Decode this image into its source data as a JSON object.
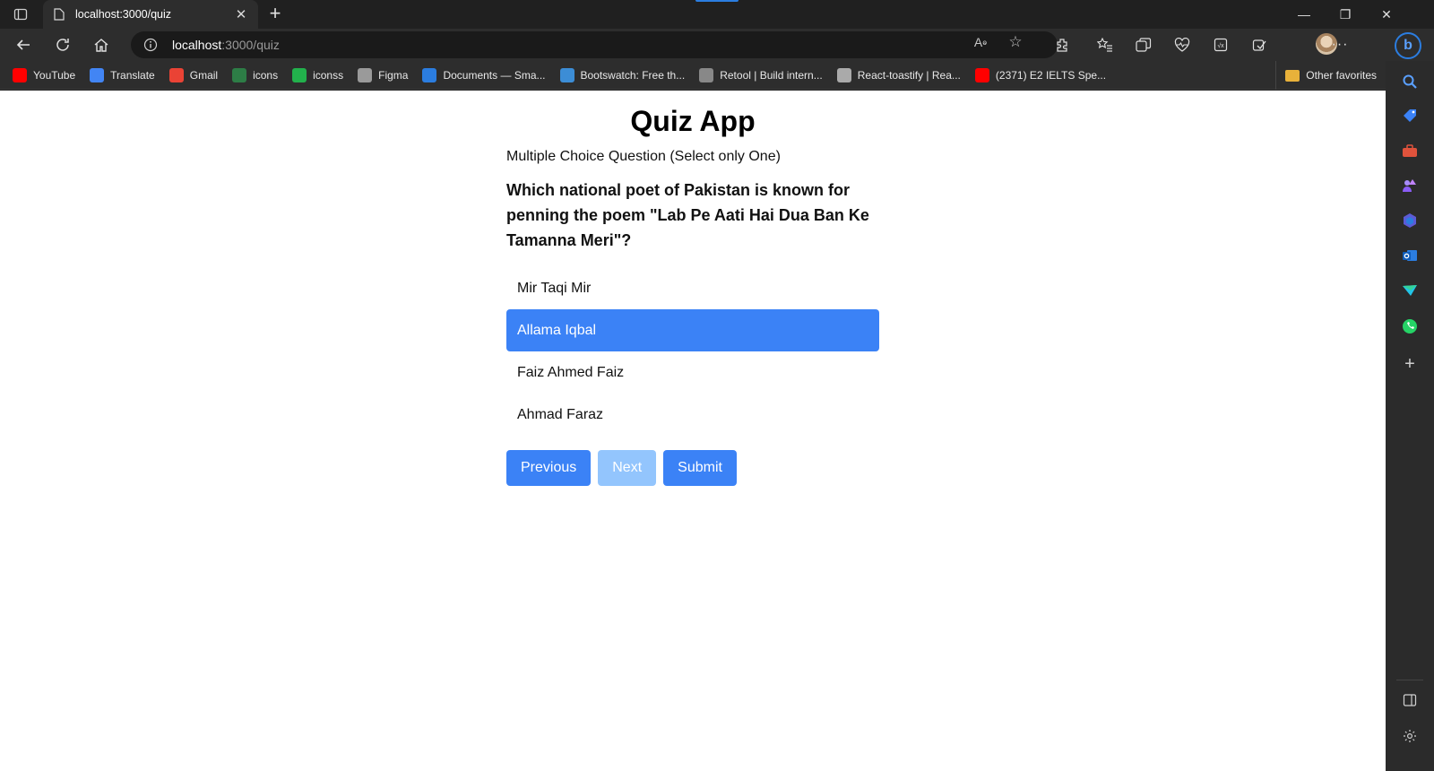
{
  "browser": {
    "tab_title": "localhost:3000/quiz",
    "address": {
      "host": "localhost",
      "path": ":3000/quiz"
    },
    "bookmarks": [
      {
        "label": "YouTube",
        "icon": "youtube-icon",
        "color": "#ff0000"
      },
      {
        "label": "Translate",
        "icon": "translate-icon",
        "color": "#4285f4"
      },
      {
        "label": "Gmail",
        "icon": "gmail-icon",
        "color": "#ea4335"
      },
      {
        "label": "icons",
        "icon": "icons8-icon",
        "color": "#2d7d46"
      },
      {
        "label": "iconss",
        "icon": "iconss-icon",
        "color": "#22b14c"
      },
      {
        "label": "Figma",
        "icon": "document-icon",
        "color": "#9a9a9a"
      },
      {
        "label": "Documents — Sma...",
        "icon": "documents-icon",
        "color": "#2b7de0"
      },
      {
        "label": "Bootswatch: Free th...",
        "icon": "bootswatch-icon",
        "color": "#3c8dd6"
      },
      {
        "label": "Retool | Build intern...",
        "icon": "retool-icon",
        "color": "#888888"
      },
      {
        "label": "React-toastify | Rea...",
        "icon": "react-toastify-icon",
        "color": "#aaaaaa"
      },
      {
        "label": "(2371) E2 IELTS Spe...",
        "icon": "youtube-icon",
        "color": "#ff0000"
      }
    ],
    "other_favorites": "Other favorites"
  },
  "quiz": {
    "title": "Quiz App",
    "question_type": "Multiple Choice Question (Select only One)",
    "question": "Which national poet of Pakistan is known for penning the poem \"Lab Pe Aati Hai Dua Ban Ke Tamanna Meri\"?",
    "options": [
      "Mir Taqi Mir",
      "Allama Iqbal",
      "Faiz Ahmed Faiz",
      "Ahmad Faraz"
    ],
    "selected_option": "Allama Iqbal",
    "buttons": {
      "previous": "Previous",
      "next": "Next",
      "submit": "Submit"
    },
    "next_disabled": true,
    "accent": "#3b82f6",
    "accent_disabled": "#93c5fd"
  }
}
